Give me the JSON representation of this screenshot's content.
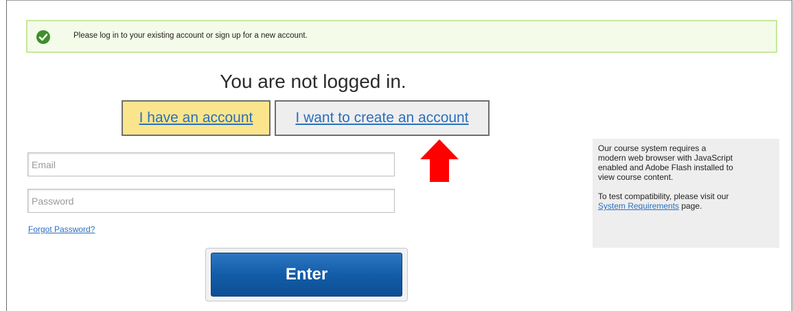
{
  "notice": {
    "icon": "check-circle-icon",
    "text": "Please log in to your existing account or sign up for a new account.",
    "background": "#f4fbe9",
    "border": "#c6e89a",
    "icon_color": "#3d8f2b"
  },
  "heading": "You are not logged in.",
  "tabs": {
    "login_label": "I have an account",
    "signup_label": "I want to create an account",
    "login_active_bg": "#fbe58c"
  },
  "annotation": {
    "icon": "red-up-arrow-icon",
    "color": "#ff0000"
  },
  "form": {
    "email_placeholder": "Email",
    "email_value": "",
    "password_placeholder": "Password",
    "password_value": "",
    "forgot_label": "Forgot Password?",
    "enter_label": "Enter"
  },
  "sidebar": {
    "lines1": [
      "Our course system requires a",
      "modern web browser with JavaScript",
      "enabled and Adobe Flash installed to",
      "view course content."
    ],
    "line2_a": "To test compatibility, please visit our",
    "link_label": "System Requirements",
    "line2_b": " page."
  },
  "colors": {
    "link": "#2a6fbf",
    "button": "#135ca8"
  }
}
